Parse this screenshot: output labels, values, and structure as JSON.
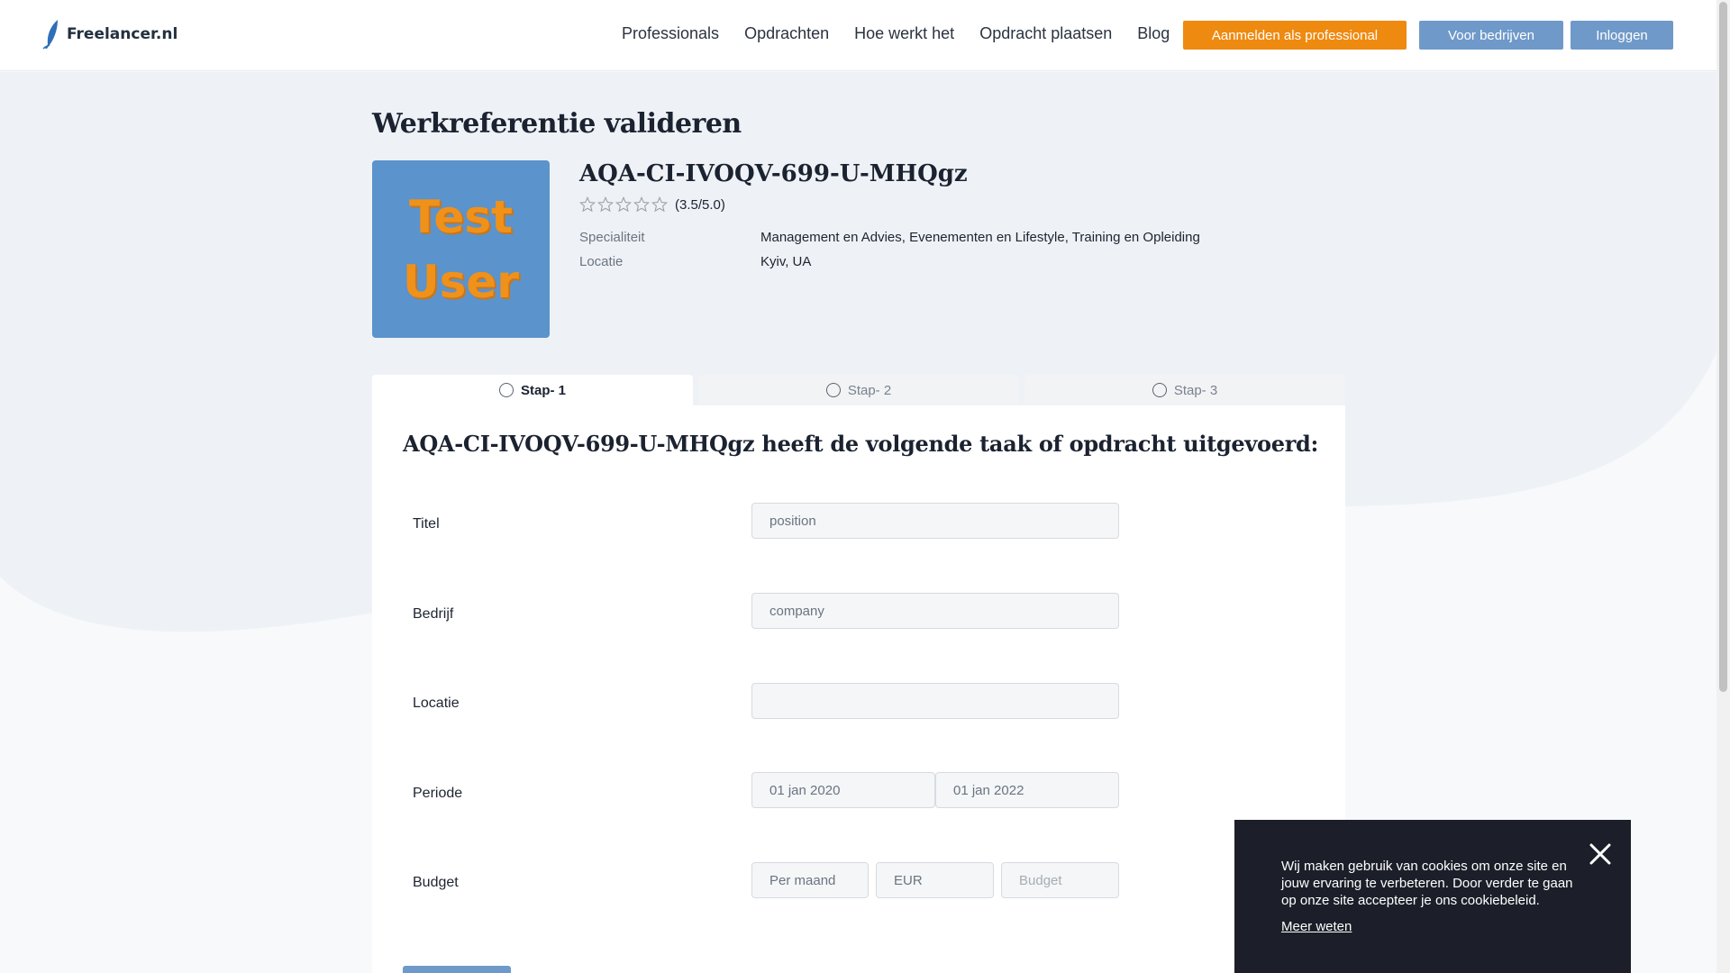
{
  "header": {
    "logo_text": "Freelancer.nl",
    "nav": [
      "Professionals",
      "Opdrachten",
      "Hoe werkt het",
      "Opdracht plaatsen",
      "Blog"
    ],
    "btn_signup": "Aanmelden als professional",
    "btn_business": "Voor bedrijven",
    "btn_login": "Inloggen"
  },
  "page": {
    "title": "Werkreferentie valideren"
  },
  "profile": {
    "avatar_line1": "Test",
    "avatar_line2": "User",
    "name": "AQA-CI-IVOQV-699-U-MHQgz",
    "rating_text": "(3.5/5.0)",
    "rating_value": 3.5,
    "rating_max": 5,
    "specialty_label": "Specialiteit",
    "specialty_value": "Management en Advies, Evenementen en Lifestyle, Training en Opleiding",
    "location_label": "Locatie",
    "location_value": "Kyiv, UA"
  },
  "tabs": [
    {
      "label": "Stap- 1",
      "active": true
    },
    {
      "label": "Stap- 2",
      "active": false
    },
    {
      "label": "Stap- 3",
      "active": false
    }
  ],
  "form": {
    "heading": "AQA-CI-IVOQV-699-U-MHQgz heeft de volgende taak of opdracht uitgevoerd:",
    "title_label": "Titel",
    "title_value": "position",
    "company_label": "Bedrijf",
    "company_value": "company",
    "location_label": "Locatie",
    "location_value": "",
    "period_label": "Periode",
    "period_start": "01 jan 2020",
    "period_end": "01 jan 2022",
    "budget_label": "Budget",
    "budget_period": "Per maand",
    "budget_currency": "EUR",
    "budget_placeholder": "Budget"
  },
  "cookie": {
    "text": "Wij maken gebruik van cookies om onze site en jouw ervaring te verbeteren. Door verder te gaan op onze site accepteer je ons cookiebeleid.",
    "link": "Meer weten"
  },
  "colors": {
    "accent_orange": "#ef8a10",
    "accent_blue": "#6f99c9",
    "cookie_bg": "#1c1f29"
  }
}
